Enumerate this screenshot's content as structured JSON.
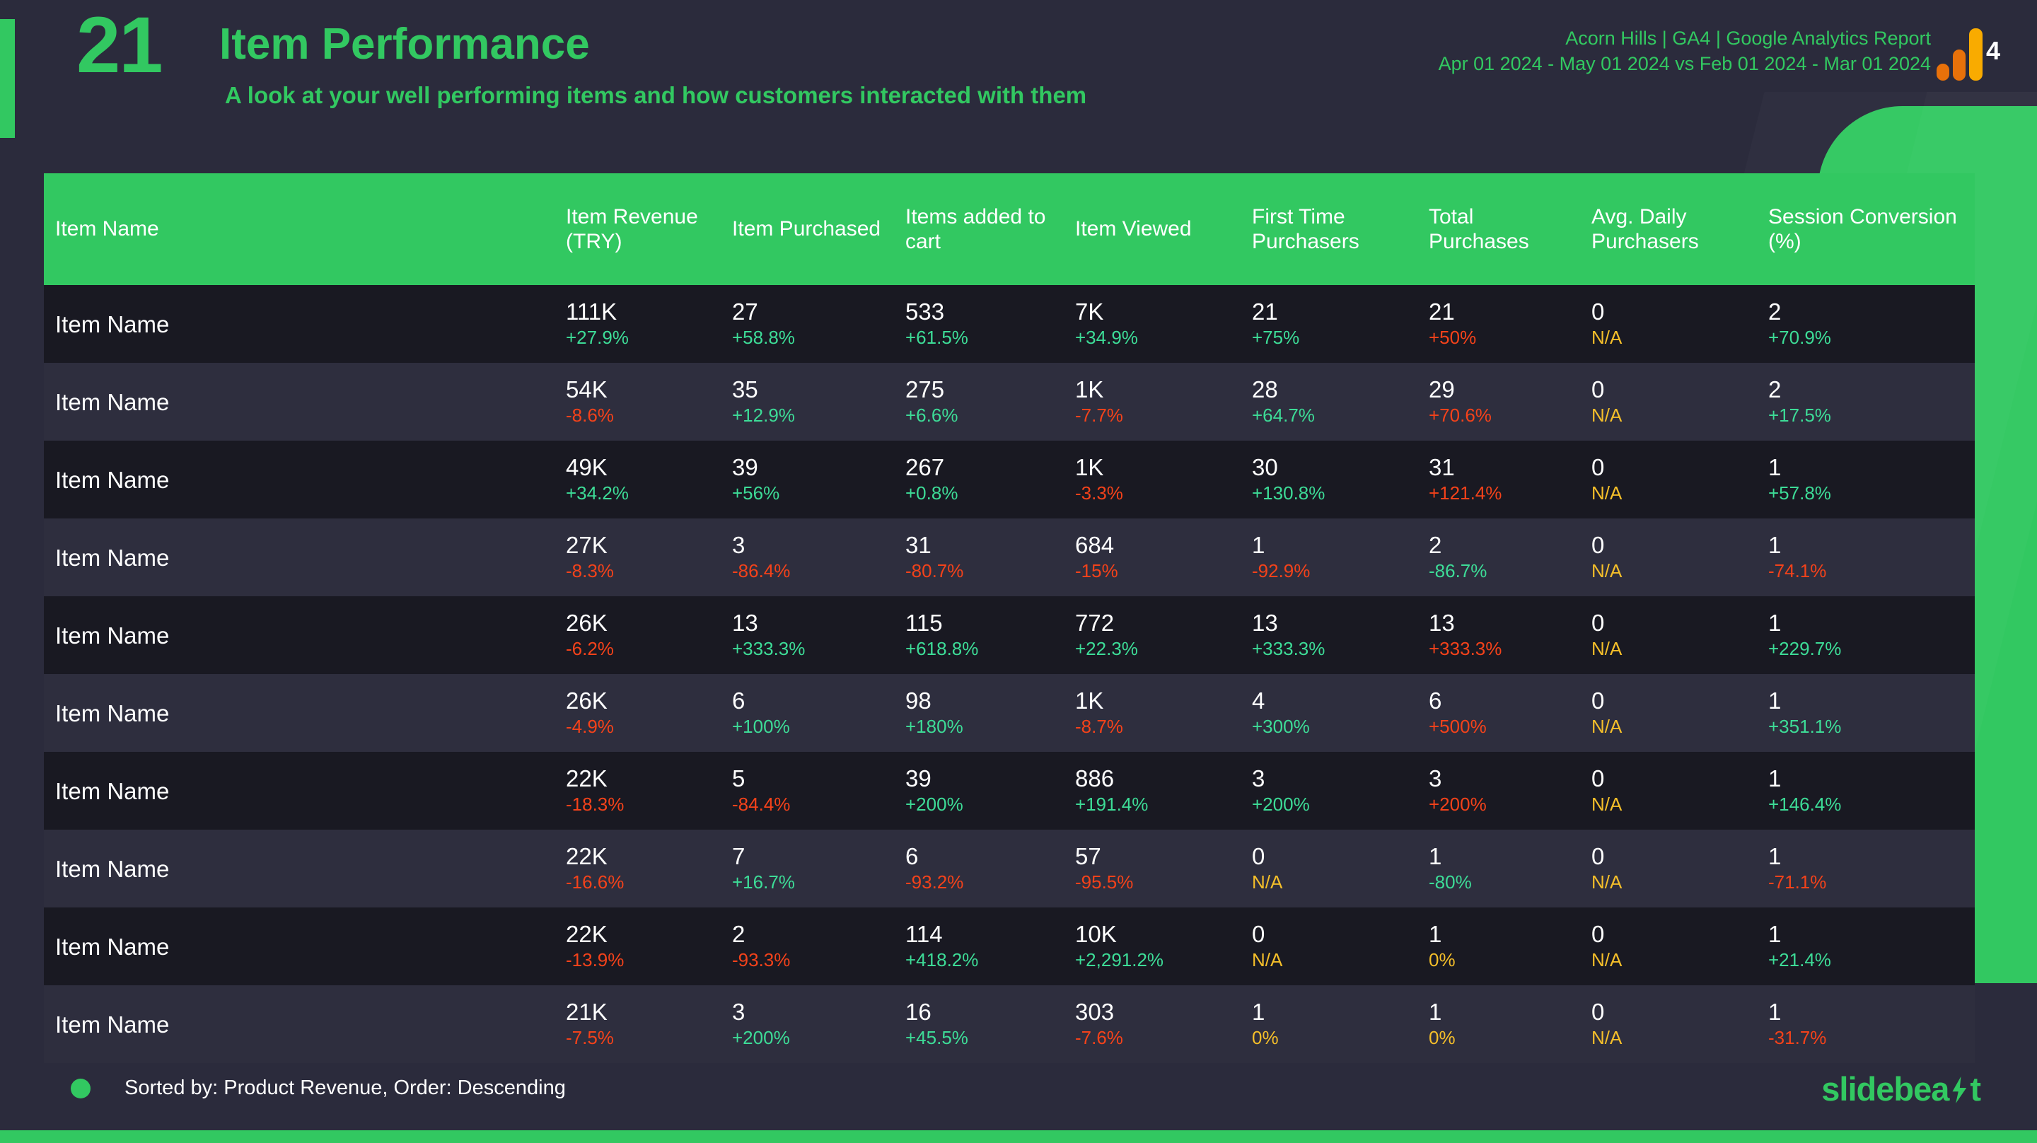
{
  "header": {
    "slide_number": "21",
    "title": "Item Performance",
    "subtitle": "A look at your well performing items and how customers interacted with them",
    "account_line": "Acorn Hills | GA4 | Google Analytics Report",
    "date_range_line": "Apr 01 2024 - May 01 2024 vs Feb 01 2024 - Mar 01 2024",
    "ga_badge": "4"
  },
  "colors": {
    "background": "#2b2b3c",
    "accent_green": "#32c861",
    "row_odd": "#191922",
    "row_even": "#2e2e3e",
    "delta_up": "#3ddc97",
    "delta_down": "#f4421a",
    "delta_na": "#f5bf2a",
    "ga_orange": "#e8710a",
    "ga_yellow": "#f9ab00"
  },
  "table": {
    "columns": [
      "Item Name",
      "Item Revenue (TRY)",
      "Item Purchased",
      "Items added to cart",
      "Item Viewed",
      "First Time Purchasers",
      "Total Purchases",
      "Avg. Daily Purchasers",
      "Session Conversion (%)"
    ],
    "rows": [
      {
        "name": "Item Name",
        "revenue": "111K",
        "revenue_delta": "+27.9%",
        "revenue_dir": "up",
        "purchased": "27",
        "purchased_delta": "+58.8%",
        "purchased_dir": "up",
        "cart": "533",
        "cart_delta": "+61.5%",
        "cart_dir": "up",
        "viewed": "7K",
        "viewed_delta": "+34.9%",
        "viewed_dir": "up",
        "first": "21",
        "first_delta": "+75%",
        "first_dir": "up",
        "total": "21",
        "total_delta": "+50%",
        "total_dir": "down",
        "avg": "0",
        "avg_delta": "N/A",
        "avg_dir": "na",
        "session": "2",
        "session_delta": "+70.9%",
        "session_dir": "up"
      },
      {
        "name": "Item Name",
        "revenue": "54K",
        "revenue_delta": "-8.6%",
        "revenue_dir": "down",
        "purchased": "35",
        "purchased_delta": "+12.9%",
        "purchased_dir": "up",
        "cart": "275",
        "cart_delta": "+6.6%",
        "cart_dir": "up",
        "viewed": "1K",
        "viewed_delta": "-7.7%",
        "viewed_dir": "down",
        "first": "28",
        "first_delta": "+64.7%",
        "first_dir": "up",
        "total": "29",
        "total_delta": "+70.6%",
        "total_dir": "down",
        "avg": "0",
        "avg_delta": "N/A",
        "avg_dir": "na",
        "session": "2",
        "session_delta": "+17.5%",
        "session_dir": "up"
      },
      {
        "name": "Item Name",
        "revenue": "49K",
        "revenue_delta": "+34.2%",
        "revenue_dir": "up",
        "purchased": "39",
        "purchased_delta": "+56%",
        "purchased_dir": "up",
        "cart": "267",
        "cart_delta": "+0.8%",
        "cart_dir": "up",
        "viewed": "1K",
        "viewed_delta": "-3.3%",
        "viewed_dir": "down",
        "first": "30",
        "first_delta": "+130.8%",
        "first_dir": "up",
        "total": "31",
        "total_delta": "+121.4%",
        "total_dir": "down",
        "avg": "0",
        "avg_delta": "N/A",
        "avg_dir": "na",
        "session": "1",
        "session_delta": "+57.8%",
        "session_dir": "up"
      },
      {
        "name": "Item Name",
        "revenue": "27K",
        "revenue_delta": "-8.3%",
        "revenue_dir": "down",
        "purchased": "3",
        "purchased_delta": "-86.4%",
        "purchased_dir": "down",
        "cart": "31",
        "cart_delta": "-80.7%",
        "cart_dir": "down",
        "viewed": "684",
        "viewed_delta": "-15%",
        "viewed_dir": "down",
        "first": "1",
        "first_delta": "-92.9%",
        "first_dir": "down",
        "total": "2",
        "total_delta": "-86.7%",
        "total_dir": "up",
        "avg": "0",
        "avg_delta": "N/A",
        "avg_dir": "na",
        "session": "1",
        "session_delta": "-74.1%",
        "session_dir": "down"
      },
      {
        "name": "Item Name",
        "revenue": "26K",
        "revenue_delta": "-6.2%",
        "revenue_dir": "down",
        "purchased": "13",
        "purchased_delta": "+333.3%",
        "purchased_dir": "up",
        "cart": "115",
        "cart_delta": "+618.8%",
        "cart_dir": "up",
        "viewed": "772",
        "viewed_delta": "+22.3%",
        "viewed_dir": "up",
        "first": "13",
        "first_delta": "+333.3%",
        "first_dir": "up",
        "total": "13",
        "total_delta": "+333.3%",
        "total_dir": "down",
        "avg": "0",
        "avg_delta": "N/A",
        "avg_dir": "na",
        "session": "1",
        "session_delta": "+229.7%",
        "session_dir": "up"
      },
      {
        "name": "Item Name",
        "revenue": "26K",
        "revenue_delta": "-4.9%",
        "revenue_dir": "down",
        "purchased": "6",
        "purchased_delta": "+100%",
        "purchased_dir": "up",
        "cart": "98",
        "cart_delta": "+180%",
        "cart_dir": "up",
        "viewed": "1K",
        "viewed_delta": "-8.7%",
        "viewed_dir": "down",
        "first": "4",
        "first_delta": "+300%",
        "first_dir": "up",
        "total": "6",
        "total_delta": "+500%",
        "total_dir": "down",
        "avg": "0",
        "avg_delta": "N/A",
        "avg_dir": "na",
        "session": "1",
        "session_delta": "+351.1%",
        "session_dir": "up"
      },
      {
        "name": "Item Name",
        "revenue": "22K",
        "revenue_delta": "-18.3%",
        "revenue_dir": "down",
        "purchased": "5",
        "purchased_delta": "-84.4%",
        "purchased_dir": "down",
        "cart": "39",
        "cart_delta": "+200%",
        "cart_dir": "up",
        "viewed": "886",
        "viewed_delta": "+191.4%",
        "viewed_dir": "up",
        "first": "3",
        "first_delta": "+200%",
        "first_dir": "up",
        "total": "3",
        "total_delta": "+200%",
        "total_dir": "down",
        "avg": "0",
        "avg_delta": "N/A",
        "avg_dir": "na",
        "session": "1",
        "session_delta": "+146.4%",
        "session_dir": "up"
      },
      {
        "name": "Item Name",
        "revenue": "22K",
        "revenue_delta": "-16.6%",
        "revenue_dir": "down",
        "purchased": "7",
        "purchased_delta": "+16.7%",
        "purchased_dir": "up",
        "cart": "6",
        "cart_delta": "-93.2%",
        "cart_dir": "down",
        "viewed": "57",
        "viewed_delta": "-95.5%",
        "viewed_dir": "down",
        "first": "0",
        "first_delta": "N/A",
        "first_dir": "na",
        "total": "1",
        "total_delta": "-80%",
        "total_dir": "up",
        "avg": "0",
        "avg_delta": "N/A",
        "avg_dir": "na",
        "session": "1",
        "session_delta": "-71.1%",
        "session_dir": "down"
      },
      {
        "name": "Item Name",
        "revenue": "22K",
        "revenue_delta": "-13.9%",
        "revenue_dir": "down",
        "purchased": "2",
        "purchased_delta": "-93.3%",
        "purchased_dir": "down",
        "cart": "114",
        "cart_delta": "+418.2%",
        "cart_dir": "up",
        "viewed": "10K",
        "viewed_delta": "+2,291.2%",
        "viewed_dir": "up",
        "first": "0",
        "first_delta": "N/A",
        "first_dir": "na",
        "total": "1",
        "total_delta": "0%",
        "total_dir": "na",
        "avg": "0",
        "avg_delta": "N/A",
        "avg_dir": "na",
        "session": "1",
        "session_delta": "+21.4%",
        "session_dir": "up"
      },
      {
        "name": "Item Name",
        "revenue": "21K",
        "revenue_delta": "-7.5%",
        "revenue_dir": "down",
        "purchased": "3",
        "purchased_delta": "+200%",
        "purchased_dir": "up",
        "cart": "16",
        "cart_delta": "+45.5%",
        "cart_dir": "up",
        "viewed": "303",
        "viewed_delta": "-7.6%",
        "viewed_dir": "down",
        "first": "1",
        "first_delta": "0%",
        "first_dir": "na",
        "total": "1",
        "total_delta": "0%",
        "total_dir": "na",
        "avg": "0",
        "avg_delta": "N/A",
        "avg_dir": "na",
        "session": "1",
        "session_delta": "-31.7%",
        "session_dir": "down"
      }
    ]
  },
  "footer": {
    "sort_note": "Sorted by: Product Revenue, Order: Descending",
    "brand_part1": "slidebea",
    "brand_part2": "t"
  }
}
